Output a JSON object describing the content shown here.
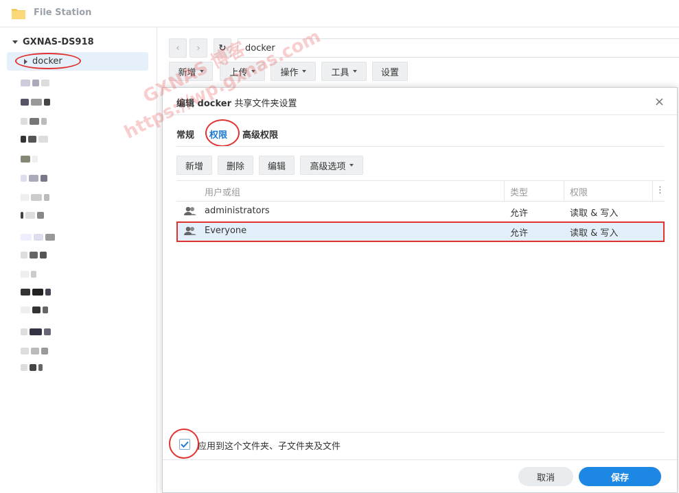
{
  "app": {
    "title": "File Station"
  },
  "sidebar": {
    "root": "GXNAS-DS918",
    "selected_folder": "docker"
  },
  "path": {
    "value": "docker"
  },
  "toolbar": {
    "new": "新增",
    "upload": "上传",
    "action": "操作",
    "tools": "工具",
    "settings": "设置"
  },
  "watermark": {
    "line1": "GXNAS 博客",
    "line2": "https://wp.gxnas.com"
  },
  "dialog": {
    "title_prefix": "编辑",
    "title_folder": "docker",
    "title_suffix": "共享文件夹设置",
    "close": "×",
    "tabs": [
      "常规",
      "权限",
      "高级权限"
    ],
    "actions": {
      "new": "新增",
      "delete": "删除",
      "edit": "编辑",
      "advanced": "高级选项"
    },
    "columns": {
      "user": "用户或组",
      "type": "类型",
      "perm": "权限"
    },
    "rows": [
      {
        "name": "administrators",
        "type": "允许",
        "perm": "读取 & 写入"
      },
      {
        "name": "Everyone",
        "type": "允许",
        "perm": "读取 & 写入"
      }
    ],
    "apply_label": "应用到这个文件夹、子文件夹及文件",
    "cancel": "取消",
    "save": "保存"
  },
  "colors": {
    "accent": "#1d87e4",
    "highlight": "#e0322f",
    "selected_row": "#e3f0fb"
  }
}
